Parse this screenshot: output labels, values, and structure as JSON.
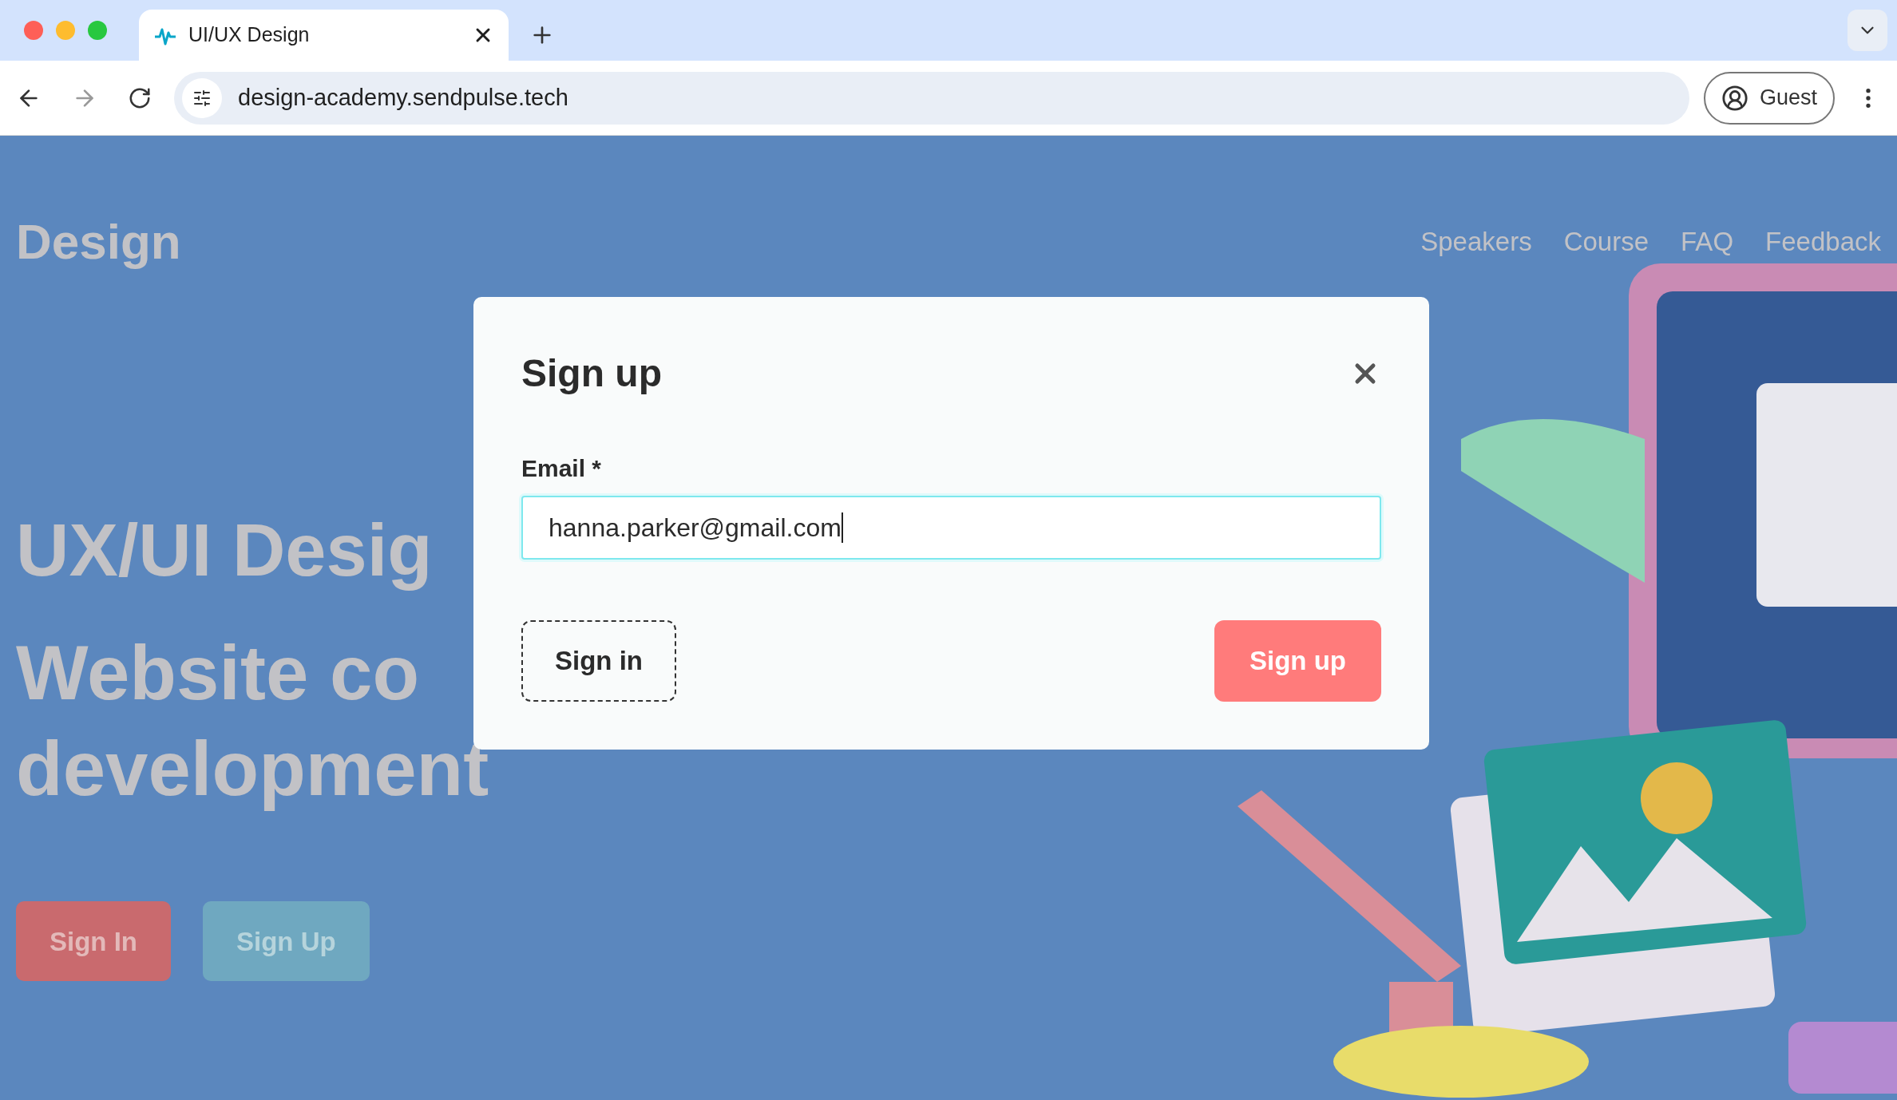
{
  "browser": {
    "tab_title": "UI/UX Design",
    "url": "design-academy.sendpulse.tech",
    "profile": "Guest"
  },
  "site": {
    "logo": "Design",
    "nav": [
      "Speakers",
      "Course",
      "FAQ",
      "Feedback"
    ],
    "hero_lines": [
      "UX/UI Desig",
      "Website co",
      "development"
    ],
    "buttons": [
      {
        "label": "Sign In",
        "kind": "primary"
      },
      {
        "label": "Sign Up",
        "kind": "secondary"
      }
    ]
  },
  "modal": {
    "title": "Sign up",
    "field": {
      "label": "Email *",
      "value": "hanna.parker@gmail.com",
      "focused": true
    },
    "secondary_button": "Sign in",
    "primary_button": "Sign up"
  }
}
